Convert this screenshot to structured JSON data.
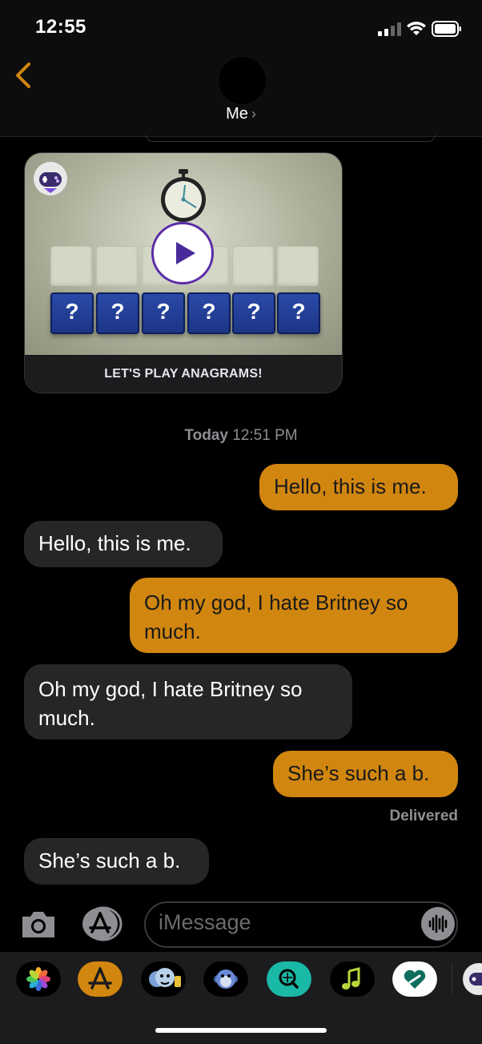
{
  "status_bar": {
    "time": "12:55"
  },
  "header": {
    "contact_name": "Me",
    "chevron": "›"
  },
  "game_card": {
    "caption": "LET'S PLAY ANAGRAMS!",
    "question_tiles": [
      "?",
      "?",
      "?",
      "?",
      "?",
      "?"
    ]
  },
  "timestamp": {
    "day": "Today",
    "time": "12:51 PM"
  },
  "messages": [
    {
      "direction": "outgoing",
      "text": "Hello, this is me."
    },
    {
      "direction": "incoming",
      "text": "Hello, this is me."
    },
    {
      "direction": "outgoing",
      "text": "Oh my god, I hate Britney so much."
    },
    {
      "direction": "incoming",
      "text": "Oh my god, I hate Britney so much."
    },
    {
      "direction": "outgoing",
      "text": "She’s such a b."
    },
    {
      "direction": "incoming",
      "text": "She’s such a b."
    }
  ],
  "delivery_status": "Delivered",
  "composer": {
    "placeholder": "iMessage"
  },
  "app_drawer": {
    "icons": [
      "photos-icon",
      "app-store-icon",
      "memoji-icon",
      "animoji-icon",
      "image-search-icon",
      "music-icon",
      "digital-touch-icon",
      "game-pigeon-icon"
    ]
  },
  "colors": {
    "accent": "#d1860f",
    "incoming_bubble": "#262628",
    "background": "#000000"
  }
}
